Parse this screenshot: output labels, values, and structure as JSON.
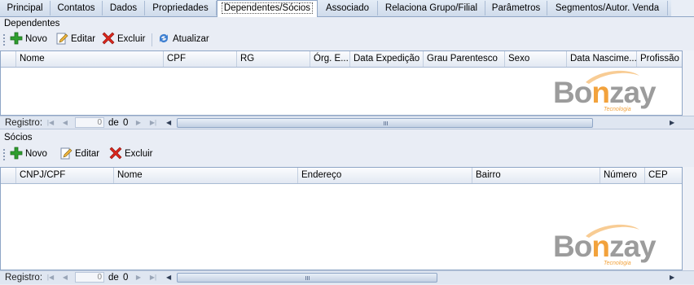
{
  "tabs": [
    {
      "label": "Principal",
      "active": false
    },
    {
      "label": "Contatos",
      "active": false
    },
    {
      "label": "Dados",
      "active": false
    },
    {
      "label": "Propriedades",
      "active": false
    },
    {
      "label": "Dependentes/Sócios",
      "active": true
    },
    {
      "label": "Associado",
      "active": false
    },
    {
      "label": "Relaciona Grupo/Filial",
      "active": false
    },
    {
      "label": "Parâmetros",
      "active": false
    },
    {
      "label": "Segmentos/Autor. Venda",
      "active": false
    }
  ],
  "dependentes": {
    "title": "Dependentes",
    "toolbar": {
      "novo": "Novo",
      "editar": "Editar",
      "excluir": "Excluir",
      "atualizar": "Atualizar"
    },
    "columns": [
      "Nome",
      "CPF",
      "RG",
      "Órg. E...",
      "Data Expedição",
      "Grau Parentesco",
      "Sexo",
      "Data Nascime...",
      "Profissão"
    ],
    "nav": {
      "label": "Registro:",
      "current": "0",
      "of": "de",
      "total": "0"
    }
  },
  "socios": {
    "title": "Sócios",
    "toolbar": {
      "novo": "Novo",
      "editar": "Editar",
      "excluir": "Excluir"
    },
    "columns": [
      "CNPJ/CPF",
      "Nome",
      "Endereço",
      "Bairro",
      "Número",
      "CEP"
    ],
    "nav": {
      "label": "Registro:",
      "current": "0",
      "of": "de",
      "total": "0"
    }
  },
  "logo": {
    "text_part1": "Bo",
    "text_accent": "n",
    "text_part2": "zay",
    "tagline": "Tecnologia"
  },
  "colors": {
    "accent": "#f2a23c",
    "logo_gray": "#9c9c9c",
    "add_green": "#2e9e2e",
    "delete_red": "#d9261c"
  },
  "icons": {
    "novo": "plus-icon",
    "editar": "edit-icon",
    "excluir": "x-icon",
    "atualizar": "refresh-icon"
  }
}
